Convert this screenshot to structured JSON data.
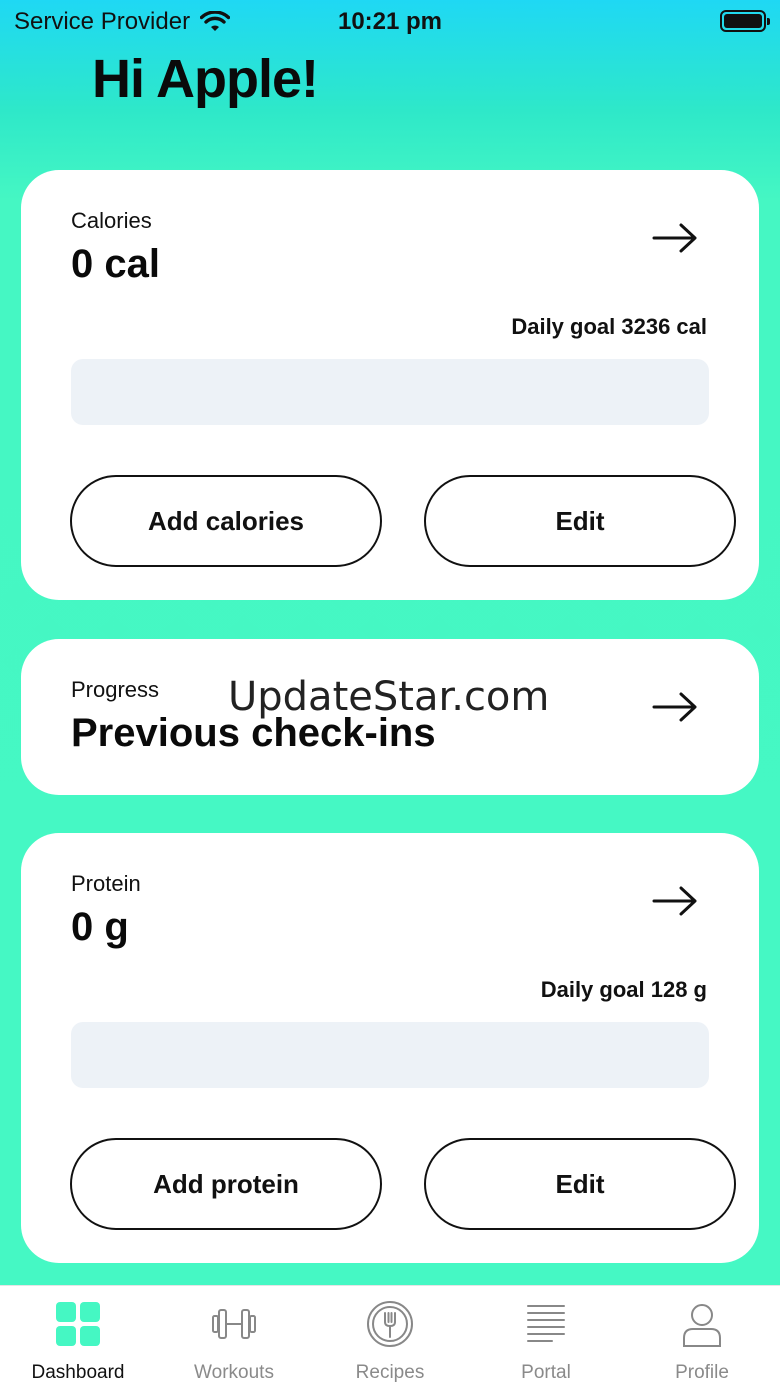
{
  "status_bar": {
    "carrier": "Service Provider",
    "time": "10:21 pm"
  },
  "greeting": "Hi Apple!",
  "calories_card": {
    "label": "Calories",
    "value": "0 cal",
    "goal": "Daily goal 3236 cal",
    "progress": 0,
    "add_button": "Add calories",
    "edit_button": "Edit"
  },
  "progress_card": {
    "label": "Progress",
    "title": "Previous check-ins"
  },
  "protein_card": {
    "label": "Protein",
    "value": "0 g",
    "goal": "Daily goal 128 g",
    "progress": 0,
    "add_button": "Add protein",
    "edit_button": "Edit"
  },
  "watermark": "UpdateStar.com",
  "tabs": [
    {
      "label": "Dashboard",
      "icon": "dashboard-grid-icon",
      "active": true
    },
    {
      "label": "Workouts",
      "icon": "dumbbell-icon",
      "active": false
    },
    {
      "label": "Recipes",
      "icon": "fork-icon",
      "active": false
    },
    {
      "label": "Portal",
      "icon": "document-lines-icon",
      "active": false
    },
    {
      "label": "Profile",
      "icon": "person-icon",
      "active": false
    }
  ],
  "colors": {
    "accent": "#45F7C3",
    "top_gradient": "#1FD8F4",
    "bar_bg": "#EDF2F7"
  }
}
